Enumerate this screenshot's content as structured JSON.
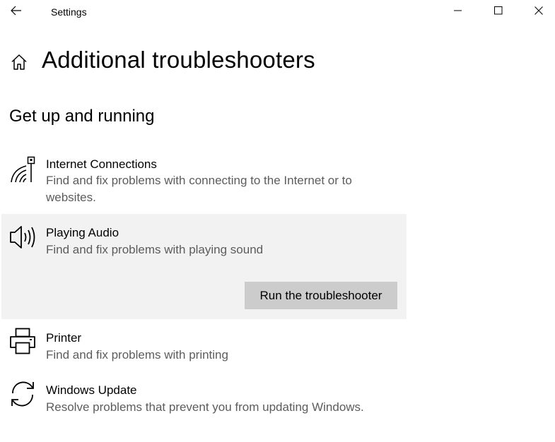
{
  "titlebar": {
    "back_icon": "back-arrow-icon",
    "title": "Settings",
    "minimize_icon": "minimize-icon",
    "maximize_icon": "maximize-icon",
    "close_icon": "close-icon"
  },
  "header": {
    "home_icon": "home-icon",
    "title": "Additional troubleshooters"
  },
  "section": {
    "title": "Get up and running"
  },
  "troubleshooters": [
    {
      "icon": "internet-connections-icon",
      "name": "Internet Connections",
      "description": "Find and fix problems with connecting to the Internet or to websites."
    },
    {
      "icon": "speaker-icon",
      "name": "Playing Audio",
      "description": "Find and fix problems with playing sound",
      "selected": true,
      "button_label": "Run the troubleshooter"
    },
    {
      "icon": "printer-icon",
      "name": "Printer",
      "description": "Find and fix problems with printing"
    },
    {
      "icon": "windows-update-icon",
      "name": "Windows Update",
      "description": "Resolve problems that prevent you from updating Windows."
    }
  ],
  "colors": {
    "selected_background": "#f2f2f2",
    "button_background": "#cccccc",
    "description_text": "#5c5c5c"
  }
}
